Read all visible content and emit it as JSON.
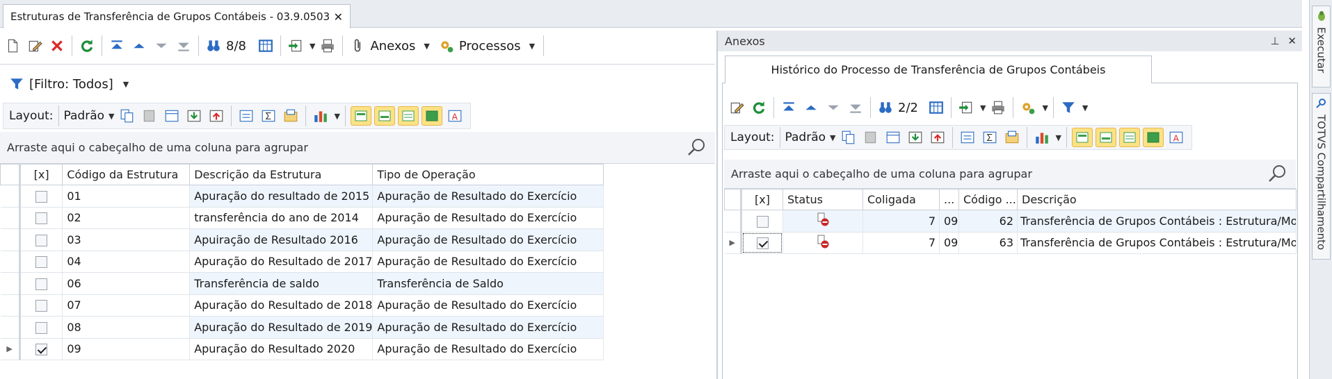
{
  "window": {
    "tab_title": "Estruturas de Transferência de Grupos Contábeis - 03.9.0503",
    "tab_close": "✕"
  },
  "toolbar": {
    "record_count": "8/8",
    "anexos_label": "Anexos",
    "processos_label": "Processos"
  },
  "filter": {
    "label": "[Filtro: Todos]"
  },
  "layout_bar": {
    "layout_label": "Layout:",
    "preset_label": "Padrão"
  },
  "group_hint": "Arraste aqui o cabeçalho de uma coluna para agrupar",
  "main_grid": {
    "columns": [
      "[x]",
      "Código da Estrutura",
      "Descrição da Estrutura",
      "Tipo de Operação"
    ],
    "rows": [
      {
        "checked": false,
        "codigo": "01",
        "descricao": "Apuração do resultado de 2015",
        "tipo": "Apuração de Resultado do Exercício"
      },
      {
        "checked": false,
        "codigo": "02",
        "descricao": "transferência do ano de 2014",
        "tipo": "Apuração de Resultado do Exercício"
      },
      {
        "checked": false,
        "codigo": "03",
        "descricao": "Apuiração de Resultado 2016",
        "tipo": "Apuração de Resultado do Exercício"
      },
      {
        "checked": false,
        "codigo": "04",
        "descricao": "Apuração do Resultado de 2017",
        "tipo": "Apuração de Resultado do Exercício"
      },
      {
        "checked": false,
        "codigo": "06",
        "descricao": "Transferência de saldo",
        "tipo": "Transferência de Saldo"
      },
      {
        "checked": false,
        "codigo": "07",
        "descricao": "Apuração do Resultado de 2018",
        "tipo": "Apuração de Resultado do Exercício"
      },
      {
        "checked": false,
        "codigo": "08",
        "descricao": "Apuração do Resultado de 2019",
        "tipo": "Apuração de Resultado do Exercício"
      },
      {
        "checked": true,
        "codigo": "09",
        "descricao": "Apuração do Resultado 2020",
        "tipo": "Apuração de Resultado do Exercício"
      }
    ]
  },
  "attachments_panel": {
    "title": "Anexos",
    "pin": "⊥",
    "close": "✕",
    "tab_label": "Histórico do Processo de Transferência de Grupos Contábeis",
    "record_count": "2/2",
    "layout_label": "Layout:",
    "preset_label": "Padrão",
    "group_hint": "Arraste aqui o cabeçalho de uma coluna para agrupar",
    "columns": [
      "[x]",
      "Status",
      "Coligada",
      "...",
      "Código ...",
      "Descrição"
    ],
    "rows": [
      {
        "checked": false,
        "coligada": "7",
        "extra": "09",
        "codigo": "62",
        "descricao": "Transferência de Grupos Contábeis : Estrutura/Molde"
      },
      {
        "checked": true,
        "coligada": "7",
        "extra": "09",
        "codigo": "63",
        "descricao": "Transferência de Grupos Contábeis : Estrutura/Molde"
      }
    ]
  },
  "side_rail": {
    "executar": "Executar",
    "totvs": "TOTVS Compartilhamento"
  },
  "colors": {
    "accent_blue": "#2b6cc4",
    "highlight_yellow": "#fbe286",
    "delete_red": "#d92b2b",
    "refresh_green": "#1e8f3a"
  }
}
